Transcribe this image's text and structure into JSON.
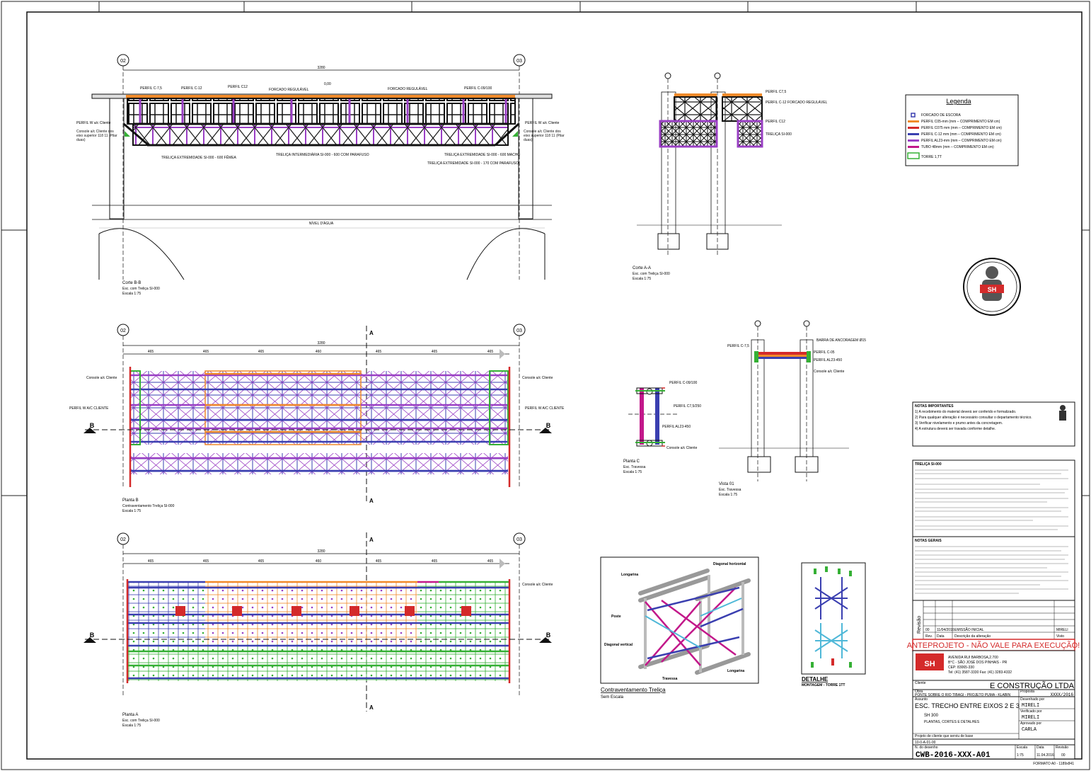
{
  "colors": {
    "blue": "#3a3fb0",
    "purple": "#9a3fc4",
    "orange": "#f08a2a",
    "green": "#35b035",
    "red": "#d42a2a",
    "magenta": "#c2188a",
    "cyan": "#4fb8d8",
    "black": "#000000"
  },
  "section_bb": {
    "axis_left": "02",
    "axis_right": "03",
    "dim_total": "3280",
    "level_label": "0,00",
    "labels": {
      "perfil_c75": "PERFIL C-7,5",
      "perfil_c12a": "PERFIL C-12",
      "perfil_c12b": "PERFIL C12",
      "forcado1": "FORCADO REGULÁVEL",
      "forcado2": "FORCADO REGULÁVEL",
      "perfil_c09": "PERFIL C-09/100",
      "perfil_w_left": "PERFIL W a/c Cliente",
      "perfil_w_right": "PERFIL W a/c Cliente",
      "console_left": "Console a/c Cliente dos eixo superior 118 11 (Pilar duas)",
      "console_right": "Console a/c Cliente dos eixo superior 118 11 (Pilar duas)",
      "trelica_ext_femea": "TRELIÇA EXTREMIDADE SI-000 - 600 FÊMEA",
      "trelica_int": "TRELIÇA INTERMEDIÁRIA SI-000 - 600 COM PARAFUSO",
      "trelica_ext_macho": "TRELIÇA EXTREMIDADE SI-000 - 600 MACHO",
      "trelica_ext_170": "TRELIÇA EXTREMIDADE SI-000 - 170 COM PARAFUSO",
      "nivel_agua": "NÍVEL D'ÁGUA"
    },
    "title": "Corte B-B",
    "sub1": "Esc. com Treliça SI-000",
    "sub2": "Escala 1:75"
  },
  "section_aa": {
    "labels": {
      "perfil_c75": "PERFIL C7,5",
      "perfil_c12_forcado": "PERFIL C-12 FORCADO REGULÁVEL",
      "perfil_c12": "PERFIL C12",
      "trelica": "TRELIÇA SI-000"
    },
    "title": "Corte A-A",
    "sub1": "Esc. com Treliça SI-000",
    "sub2": "Escala 1:75"
  },
  "legend": {
    "title": "Legenda",
    "items": [
      "FORCADO DE ESCORA",
      "PERFIL C05-mm (mm – COMPRIMENTO EM cm)",
      "PERFIL C075 mm (mm – COMPRIMENTO EM cm)",
      "PERFIL C-12 mm (mm – COMPRIMENTO EM cm)",
      "PERFIL AL23-mm (mm – COMPRIMENTO EM cm)",
      "TUBO 48mm (mm – COMPRIMENTO EM cm)",
      "TORRE 1,TT"
    ]
  },
  "plan_b": {
    "axis_left": "02",
    "axis_right": "03",
    "dim_total": "3280",
    "spans": [
      "465",
      "465",
      "465",
      "460",
      "465",
      "465",
      "465"
    ],
    "section_mark": "A",
    "cut_mark": "B",
    "console_left": "Console a/c Cliente",
    "console_right": "Console a/c Cliente",
    "perfil_w_left": "PERFIL W A/C CLIENTE",
    "perfil_w_right": "PERFIL W A/C CLIENTE",
    "title": "Planta B",
    "sub1": "Contraventamento Treliça SI-000",
    "sub2": "Escala 1:75"
  },
  "plan_a": {
    "axis_left": "02",
    "axis_right": "03",
    "dim_total": "3280",
    "spans": [
      "465",
      "465",
      "465",
      "460",
      "465",
      "465",
      "465"
    ],
    "section_mark": "A",
    "cut_mark": "B",
    "console_right": "Console a/c Cliente",
    "title": "Planta A",
    "sub1": "Esc. com Treliça SI-000",
    "sub2": "Escala 1:75"
  },
  "plan_c": {
    "labels": {
      "perfil_c09": "PERFIL C-09/100",
      "perfil_c7": "PERFIL C7,5/250",
      "perfil_al": "PERFIL AL23-450",
      "console": "Console a/c Cliente"
    },
    "title": "Planta C",
    "sub1": "Esc. Travessa",
    "sub2": "Escala 1:75"
  },
  "view_01": {
    "labels": {
      "barra": "BARRA DE ANCORAGEM Ø15",
      "perfil_c75": "PERFIL C-7,5",
      "perfil_c05": "PERFIL C-05",
      "perfil_al": "PERFIL AL23-450",
      "console": "Console a/c Cliente"
    },
    "title": "Vista 01",
    "sub1": "Esc. Travessa",
    "sub2": "Escala 1:75"
  },
  "iso": {
    "labels": {
      "longarina1": "Longarina",
      "diagonal_h": "Diagonal horizontal",
      "poste": "Poste",
      "diagonal_v": "Diagonal vertical",
      "longarina2": "Longarina",
      "travessa": "Travessa"
    },
    "title": "Contraventamento Treliça",
    "sub": "Sem Escala"
  },
  "detail": {
    "title": "DETALHE",
    "sub": "MONTAGEM - TORRE 1TT"
  },
  "notes": {
    "block1_title": "NOTAS IMPORTANTES",
    "block2_title": "TRELIÇA SI-000",
    "block3_title": "NOTAS GERAIS",
    "n1": "1) A recebimento do material deverá ser conferido e formalizado.",
    "n2": "2) Para qualquer alteração é necessário consultar o departamento técnico.",
    "n3": "3) Verificar nivelamento e prumo antes da concretagem.",
    "n4": "4) A estrutura deverá ser travada conforme detalhe."
  },
  "revision": {
    "rev_label": "Revisão",
    "row_rev": "00",
    "row_date": "11/04/2016",
    "row_desc": "EMISSÃO INICIAL",
    "row_by": "MIRELI",
    "hdr_rev": "Rev.",
    "hdr_date": "Data",
    "hdr_desc": "Descrição da alteração",
    "hdr_by": "Visto"
  },
  "title_block": {
    "banner": "ANTEPROJETO - NÃO VALE PARA EXECUÇÃO!",
    "logo": "SH",
    "address1": "AVENIDA RUI BARBOSA,2.700",
    "address2": "B°C - SÃO JOSÉ DOS PINHAIS - PR",
    "address3": "CEP: 83065-330",
    "address4": "Tel: (41) 3587-3330 Fax: (41) 3283-4332",
    "client_label": "Cliente",
    "client": "E CONSTRUÇÃO LTDA",
    "work_label": "Obra",
    "work": "PONTE SOBRE O RIO TIBAGI - PROJETO PUMA - KLABIN",
    "proposal_label": "Proposta",
    "proposal": "XXXX/2016",
    "subject_label": "Assunto",
    "subject": "ESC. TRECHO ENTRE EIXOS 2 E 3",
    "sub_subject1": "SH 300",
    "sub_subject2": "PLANTAS, CORTES E DETALHES",
    "drawn_label": "Desenhado por",
    "drawn": "MIRELI",
    "checked_label": "Verificado por",
    "checked": "MIRELI",
    "approved_label": "Aprovado por",
    "approved": "CARLA",
    "project_label": "Projeto de cliente que serviu de base",
    "project_ref": "10-0-A-01-00",
    "number_label": "N. do desenho",
    "number": "CWB-2016-XXX-A01",
    "scale_label": "Escala",
    "scale": "1:75",
    "date_label": "Data",
    "date": "11.04.2016",
    "rev_label": "Revisão",
    "rev": "00",
    "format": "FORMATO A0 - 1189x841"
  }
}
